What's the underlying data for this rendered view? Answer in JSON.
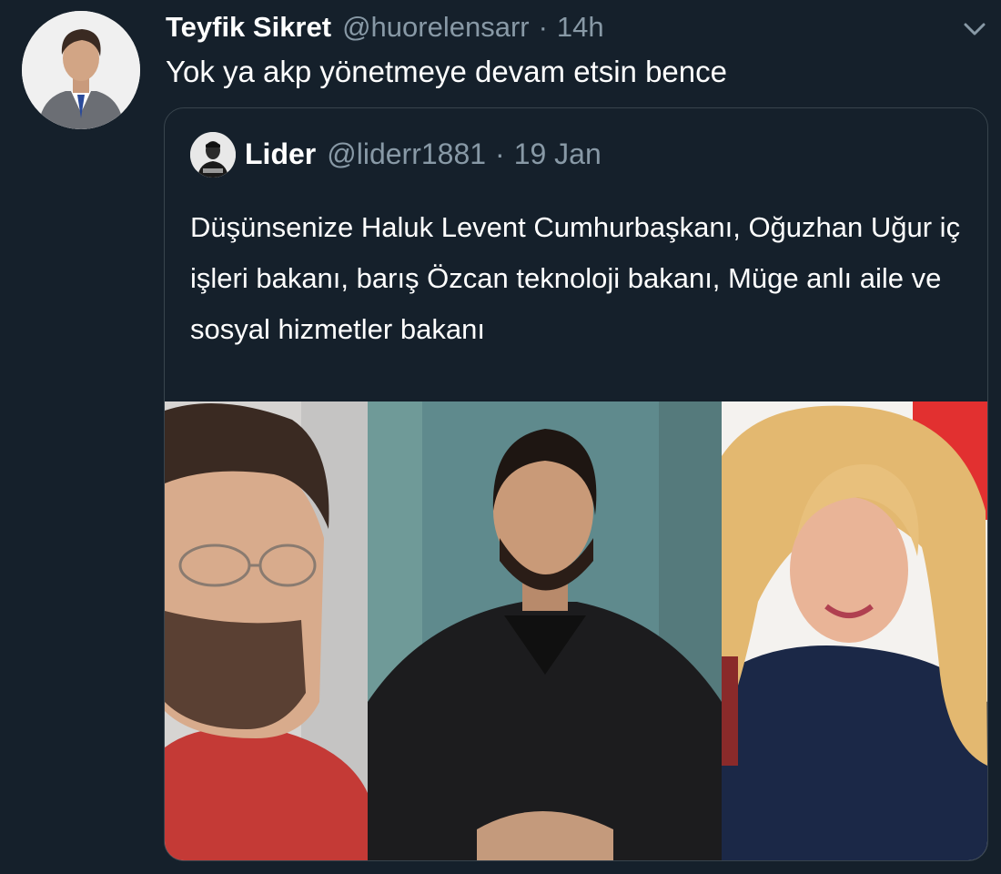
{
  "tweet": {
    "author_name": "Teyfik Sikret",
    "author_handle": "@huorelensarr",
    "separator": "·",
    "time": "14h",
    "text": "Yok ya akp yönetmeye devam etsin bence"
  },
  "quoted_tweet": {
    "author_name": "Lider",
    "author_handle": "@liderr1881",
    "separator": "·",
    "time": "19 Jan",
    "text": "Düşünsenize Haluk Levent Cumhurbaşkanı, Oğuzhan Uğur iç işleri bakanı, barış Özcan teknoloji bakanı, Müge anlı aile ve sosyal hizmetler bakanı"
  },
  "icons": {
    "menu": "chevron-down-icon",
    "avatar": "user-avatar-photo",
    "quoted_avatar": "portrait-avatar"
  },
  "colors": {
    "background": "#15202b",
    "border": "#38444d",
    "secondary_text": "#8899a6",
    "primary_text": "#ffffff"
  }
}
